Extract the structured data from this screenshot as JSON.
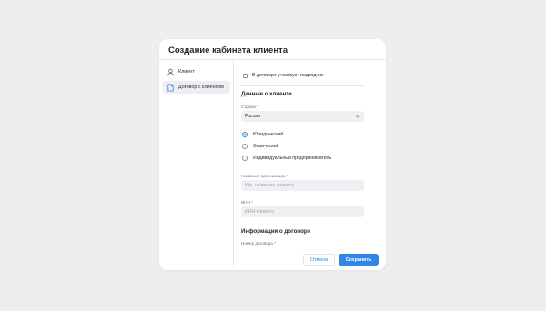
{
  "modal": {
    "title": "Создание кабинета клиента"
  },
  "sidebar": {
    "items": [
      {
        "label": "Клиент",
        "icon": "user-icon",
        "active": false
      },
      {
        "label": "Договор с клиентом",
        "icon": "document-icon",
        "active": true
      }
    ]
  },
  "form": {
    "contractor_checkbox_label": "В договоре участвует подрядчик",
    "contractor_checked": false,
    "client_section_title": "Данные о клиенте",
    "country": {
      "label": "Страна",
      "required_mark": "*",
      "value": "Россия"
    },
    "legal_types": [
      {
        "label": "Юридический",
        "checked": true
      },
      {
        "label": "Физический",
        "checked": false
      },
      {
        "label": "Индивидуальный предприниматель",
        "checked": false
      }
    ],
    "org_name": {
      "label": "Название организации",
      "required_mark": "*",
      "placeholder": "Юр. название клиента"
    },
    "inn": {
      "label": "ИНН",
      "required_mark": "*",
      "placeholder": "ИНН клиента"
    },
    "contract_section_title": "Информация о договоре",
    "contract_number": {
      "label": "Номер договора",
      "required_mark": "*"
    }
  },
  "footer": {
    "cancel_label": "Отмена",
    "save_label": "Сохранить"
  },
  "colors": {
    "accent": "#2f86e8",
    "required": "#e34d3f",
    "background": "#eeeef0"
  }
}
